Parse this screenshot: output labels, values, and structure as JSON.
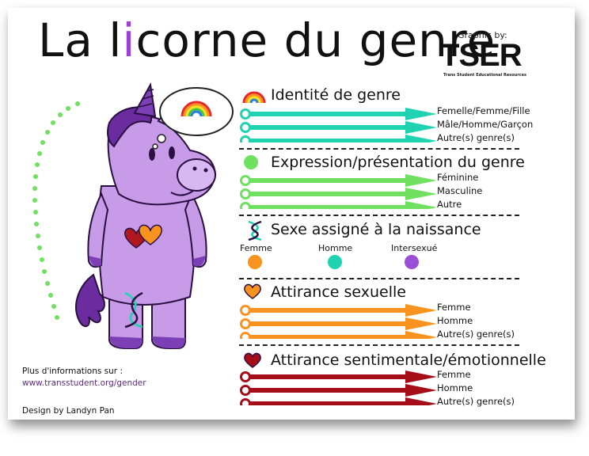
{
  "title": {
    "before": "La l",
    "accent": "i",
    "after": "corne du genre"
  },
  "credit": {
    "graphic_by": "Graphic by:",
    "logo": "TSER",
    "logo_sub": "Trans Student Educational Resources"
  },
  "sections": {
    "identity": {
      "title": "Identité de genre",
      "color": "#1fd3b0",
      "bars": [
        "Femelle/Femme/Fille",
        "Mâle/Homme/Garçon",
        "Autre(s) genre(s)"
      ]
    },
    "expression": {
      "title": "Expression/présentation du genre",
      "color": "#6fe05f",
      "bars": [
        "Féminine",
        "Masculine",
        "Autre"
      ]
    },
    "sex": {
      "title": "Sexe assigné à la naissance",
      "options": [
        {
          "label": "Femme",
          "color": "#f7931e"
        },
        {
          "label": "Homme",
          "color": "#1fd3b0"
        },
        {
          "label": "Intersexué",
          "color": "#9b4fd6"
        }
      ]
    },
    "sexual": {
      "title": "Attirance sexuelle",
      "color": "#f7931e",
      "bars": [
        "Femme",
        "Homme",
        "Autre(s) genre(s)"
      ]
    },
    "romantic": {
      "title": "Attirance sentimentale/émotionnelle",
      "color": "#a50e18",
      "bars": [
        "Femme",
        "Homme",
        "Autre(s) genre(s)"
      ]
    }
  },
  "footer": {
    "more_info": "Plus d'informations sur :",
    "link": "www.transstudent.org/gender",
    "design_by": "Design by Landyn Pan"
  },
  "icons": [
    "rainbow-icon",
    "green-circle-icon",
    "dna-icon",
    "orange-heart-icon",
    "red-heart-icon",
    "unicorn-illustration",
    "thought-bubble-icon",
    "heart-pair-icon"
  ]
}
